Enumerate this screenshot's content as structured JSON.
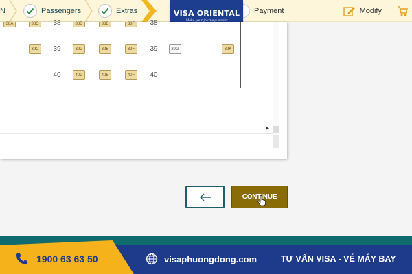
{
  "stepbar": {
    "partial_label": "N",
    "steps": [
      {
        "label": "Passengers",
        "done": true
      },
      {
        "label": "Extras",
        "done": true
      },
      {
        "label": "Payment",
        "done": false
      }
    ],
    "modify_label": "Modify"
  },
  "logo": {
    "name": "VISA ORIENTAL",
    "tagline": "Make your journeys easier"
  },
  "seatmap": {
    "rows": [
      {
        "number": "38",
        "seats": [
          "38A",
          "38C",
          "38D",
          "38E",
          "38F"
        ]
      },
      {
        "number": "39",
        "seats": [
          "39C",
          "39D",
          "39E",
          "39F",
          "39G",
          "39K"
        ],
        "available": [
          "39G"
        ]
      },
      {
        "number": "40",
        "seats": [
          "40D",
          "40E",
          "40F"
        ]
      }
    ]
  },
  "buttons": {
    "continue_label": "CONTINUE"
  },
  "footer": {
    "phone": "1900 63 63 50",
    "website": "visaphuongdong.com",
    "slogan": "TƯ VẤN VISA - VÉ MÁY BAY"
  },
  "colors": {
    "accent_gold": "#8a6c06",
    "teal": "#1f5e6b",
    "brand_blue": "#1e3a8a",
    "footer_yellow": "#f5b21b"
  }
}
